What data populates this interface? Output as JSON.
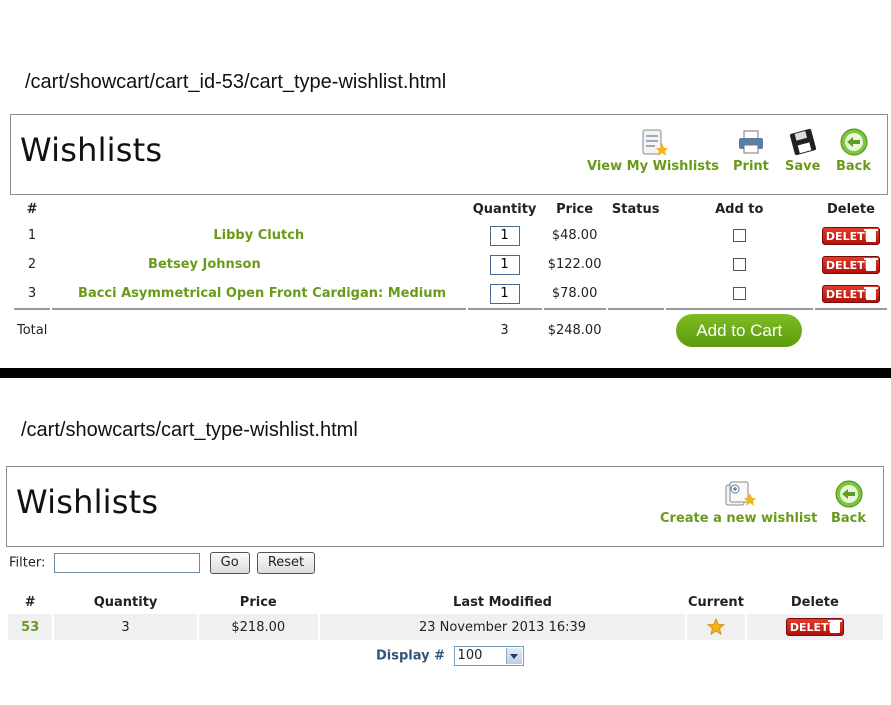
{
  "top": {
    "url": "/cart/showcart/cart_id-53/cart_type-wishlist.html",
    "title": "Wishlists",
    "tools": {
      "view": "View My Wishlists",
      "print": "Print",
      "save": "Save",
      "back": "Back"
    },
    "columns": {
      "num": "#",
      "qty": "Quantity",
      "price": "Price",
      "status": "Status",
      "add": "Add to",
      "del": "Delete"
    },
    "rows": [
      {
        "num": "1",
        "name": "Libby Clutch",
        "qty": "1",
        "price": "$48.00"
      },
      {
        "num": "2",
        "name": "Betsey Johnson",
        "qty": "1",
        "price": "$122.00"
      },
      {
        "num": "3",
        "name": "Bacci Asymmetrical Open Front Cardigan: Medium",
        "qty": "1",
        "price": "$78.00"
      }
    ],
    "delete_label": "DELETE",
    "total": {
      "label": "Total",
      "qty": "3",
      "price": "$248.00"
    },
    "add_to_cart": "Add to Cart"
  },
  "bottom": {
    "url": "/cart/showcarts/cart_type-wishlist.html",
    "title": "Wishlists",
    "tools": {
      "create": "Create a new wishlist",
      "back": "Back"
    },
    "filter": {
      "label": "Filter:",
      "go": "Go",
      "reset": "Reset",
      "value": ""
    },
    "columns": {
      "num": "#",
      "qty": "Quantity",
      "price": "Price",
      "modified": "Last Modified",
      "current": "Current",
      "del": "Delete"
    },
    "rows": [
      {
        "num": "53",
        "qty": "3",
        "price": "$218.00",
        "modified": "23 November 2013 16:39"
      }
    ],
    "delete_label": "DELETE",
    "display_label": "Display #",
    "display_value": "100"
  },
  "colors": {
    "accent": "#6a9a1a",
    "delete": "#c8140e",
    "button_green": "#6aab17"
  }
}
